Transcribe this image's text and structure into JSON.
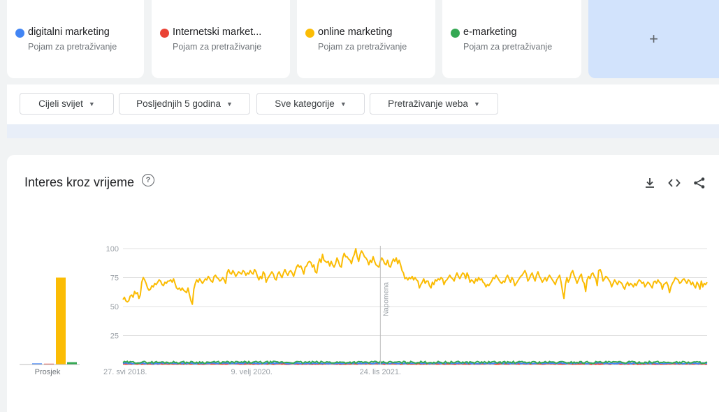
{
  "terms": [
    {
      "label": "digitalni marketing",
      "sublabel": "Pojam za pretraživanje",
      "color": "#4285f4"
    },
    {
      "label": "Internetski market...",
      "sublabel": "Pojam za pretraživanje",
      "color": "#ea4335"
    },
    {
      "label": "online marketing",
      "sublabel": "Pojam za pretraživanje",
      "color": "#fbbc04"
    },
    {
      "label": "e-marketing",
      "sublabel": "Pojam za pretraživanje",
      "color": "#34a853"
    }
  ],
  "add_label": "+",
  "filters": {
    "region": "Cijeli svijet",
    "time": "Posljednjih 5 godina",
    "category": "Sve kategorije",
    "search_type": "Pretraživanje weba"
  },
  "section_title": "Interes kroz vrijeme",
  "help_glyph": "?",
  "chart_data": {
    "type": "line",
    "ylim": [
      0,
      100
    ],
    "yticks": [
      25,
      50,
      75,
      100
    ],
    "xtick_labels": [
      "27. svi 2018.",
      "9. velj 2020.",
      "24. lis 2021."
    ],
    "xtick_weeks": [
      0,
      89,
      178
    ],
    "annotation": {
      "label": "Napomena",
      "week": 178
    },
    "average_label": "Prosjek",
    "series": [
      {
        "name": "digitalni marketing",
        "color": "#4285f4",
        "average": 1,
        "values_note": "≈1 each week"
      },
      {
        "name": "Internetski market...",
        "color": "#ea4335",
        "average": 0,
        "values_note": "≈0-1 each week"
      },
      {
        "name": "online marketing",
        "color": "#fbbc04",
        "average": 75,
        "values": [
          56,
          58,
          55,
          54,
          55,
          59,
          60,
          58,
          63,
          61,
          62,
          57,
          60,
          71,
          75,
          73,
          70,
          66,
          64,
          65,
          68,
          67,
          70,
          69,
          71,
          73,
          72,
          69,
          68,
          71,
          70,
          72,
          72,
          73,
          71,
          74,
          70,
          66,
          65,
          66,
          64,
          66,
          64,
          63,
          62,
          66,
          60,
          55,
          52,
          65,
          70,
          73,
          71,
          74,
          72,
          70,
          72,
          74,
          73,
          76,
          74,
          72,
          71,
          76,
          77,
          75,
          74,
          72,
          73,
          75,
          73,
          70,
          79,
          82,
          79,
          78,
          81,
          79,
          76,
          78,
          80,
          79,
          78,
          81,
          80,
          77,
          79,
          78,
          81,
          79,
          78,
          82,
          80,
          76,
          73,
          76,
          74,
          80,
          78,
          71,
          74,
          76,
          78,
          80,
          78,
          74,
          73,
          78,
          80,
          77,
          75,
          79,
          82,
          79,
          77,
          80,
          81,
          79,
          76,
          80,
          84,
          86,
          84,
          85,
          82,
          78,
          84,
          85,
          88,
          89,
          88,
          84,
          86,
          80,
          79,
          87,
          91,
          88,
          95,
          90,
          89,
          88,
          89,
          85,
          89,
          86,
          84,
          87,
          92,
          89,
          85,
          84,
          92,
          96,
          93,
          93,
          91,
          90,
          87,
          92,
          95,
          100,
          93,
          89,
          95,
          98,
          96,
          93,
          92,
          90,
          86,
          90,
          88,
          93,
          89,
          86,
          85,
          84,
          89,
          92,
          90,
          87,
          86,
          90,
          85,
          84,
          88,
          91,
          89,
          92,
          87,
          90,
          86,
          81,
          79,
          74,
          75,
          73,
          75,
          74,
          76,
          73,
          75,
          73,
          72,
          66,
          69,
          71,
          74,
          70,
          72,
          72,
          68,
          66,
          71,
          69,
          73,
          72,
          74,
          73,
          75,
          74,
          69,
          72,
          73,
          75,
          77,
          75,
          74,
          72,
          76,
          79,
          76,
          74,
          77,
          79,
          78,
          74,
          79,
          76,
          71,
          73,
          72,
          70,
          74,
          72,
          75,
          73,
          74,
          71,
          70,
          67,
          69,
          68,
          70,
          72,
          75,
          74,
          77,
          75,
          73,
          71,
          70,
          72,
          71,
          75,
          77,
          74,
          71,
          75,
          73,
          68,
          70,
          72,
          74,
          76,
          77,
          79,
          81,
          78,
          72,
          74,
          77,
          79,
          75,
          72,
          77,
          80,
          76,
          74,
          71,
          73,
          75,
          72,
          75,
          77,
          75,
          73,
          71,
          69,
          73,
          75,
          77,
          71,
          63,
          57,
          69,
          75,
          71,
          74,
          79,
          81,
          77,
          74,
          70,
          73,
          76,
          78,
          72,
          70,
          63,
          73,
          76,
          74,
          78,
          79,
          76,
          74,
          68,
          81,
          82,
          79,
          72,
          74,
          76,
          75,
          73,
          71,
          67,
          70,
          73,
          71,
          69,
          72,
          71,
          70,
          67,
          65,
          69,
          71,
          68,
          70,
          69,
          67,
          70,
          68,
          71,
          73,
          72,
          70,
          71,
          67,
          69,
          71,
          70,
          68,
          66,
          71,
          72,
          70,
          73,
          71,
          70,
          65,
          69,
          70,
          71,
          68,
          62,
          67,
          70,
          72,
          75,
          74,
          73,
          70,
          71,
          73,
          74,
          72,
          70,
          73,
          72,
          69,
          71,
          68,
          66,
          71,
          69,
          65,
          72,
          67,
          70,
          69,
          71
        ]
      },
      {
        "name": "e-marketing",
        "color": "#34a853",
        "average": 2,
        "values_note": "≈1-3 each week"
      }
    ]
  }
}
